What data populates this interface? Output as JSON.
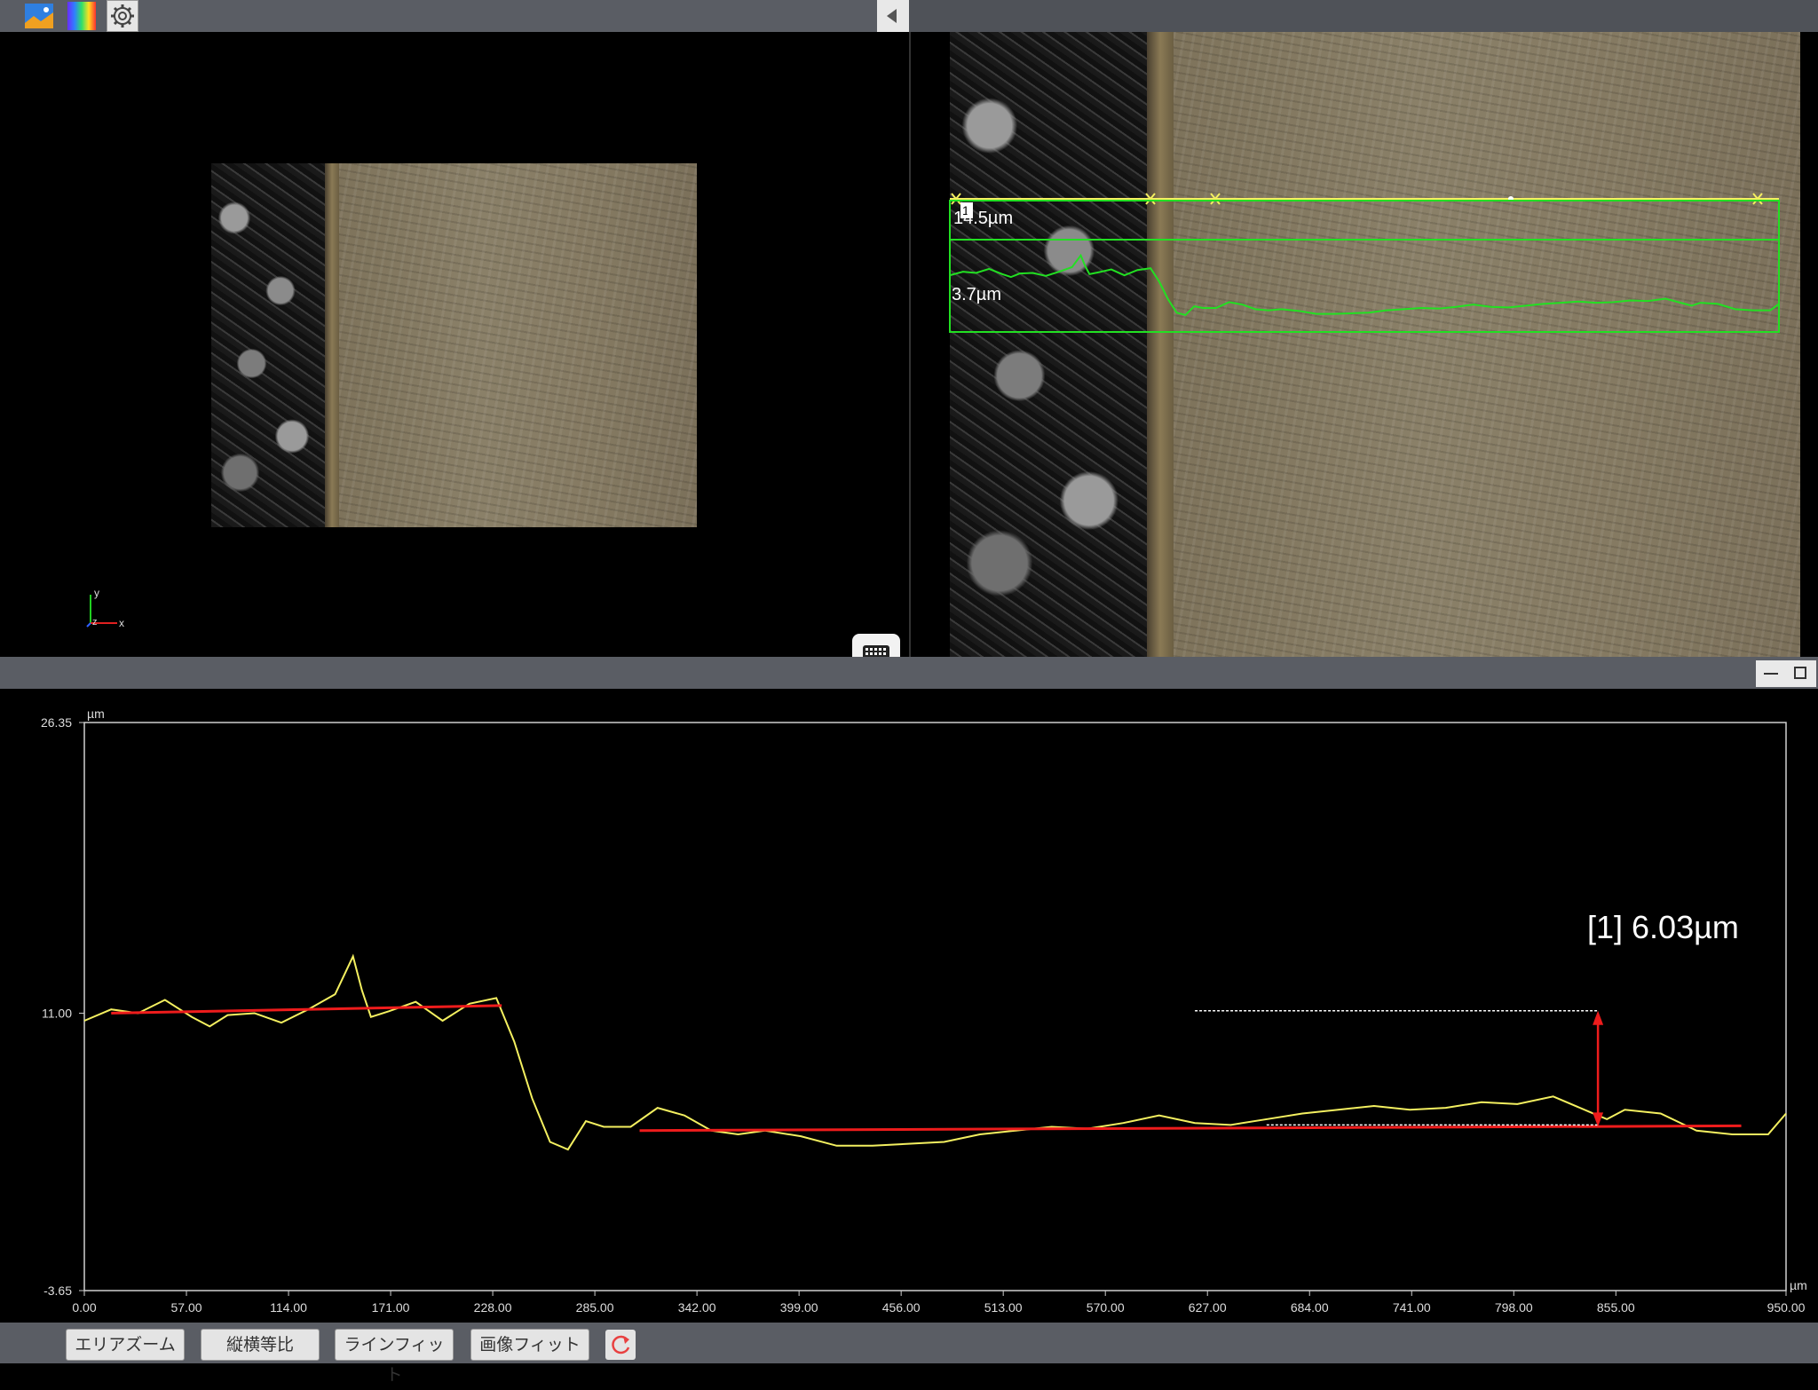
{
  "toolbar": {
    "icons": [
      "image-mode-icon",
      "color-map-icon",
      "gear-icon"
    ],
    "collapse": "chevron-left-icon"
  },
  "views": {
    "left_axes": {
      "y": "y",
      "z": "z",
      "x": "x"
    },
    "right_overlay": {
      "box_marker": "1",
      "upper_label": "14.5µm",
      "lower_label": "3.7µm",
      "colors": {
        "profile_line": "#f4f060",
        "box": "#22e022",
        "trace": "#22e022"
      }
    }
  },
  "chart": {
    "y_unit": "µm",
    "x_unit": "µm",
    "y_ticks": [
      "26.35",
      "11.00",
      "-3.65"
    ],
    "x_ticks": [
      "0.00",
      "57.00",
      "114.00",
      "171.00",
      "228.00",
      "285.00",
      "342.00",
      "399.00",
      "456.00",
      "513.00",
      "570.00",
      "627.00",
      "684.00",
      "741.00",
      "798.00",
      "855.00",
      "950.00"
    ],
    "measurement_label": "[1] 6.03µm",
    "colors": {
      "profile": "#f4f060",
      "fit_line": "#ee1c1c",
      "arrow": "#ee1c1c",
      "frame": "#cfcfcf"
    }
  },
  "chart_data": {
    "type": "line",
    "xlim": [
      0,
      950
    ],
    "ylim": [
      -3.65,
      26.35
    ],
    "xlabel": "µm",
    "ylabel": "µm",
    "series": [
      {
        "x": [
          0,
          15,
          30,
          45,
          60,
          70,
          80,
          95,
          110,
          125,
          140,
          150,
          155,
          160,
          170,
          185,
          200,
          215,
          230,
          240,
          250,
          260,
          270,
          280,
          290,
          305,
          320,
          335,
          350,
          365,
          380,
          400,
          420,
          440,
          460,
          480,
          500,
          520,
          540,
          560,
          580,
          600,
          620,
          640,
          660,
          680,
          700,
          720,
          740,
          760,
          780,
          800,
          820,
          840,
          850,
          860,
          880,
          900,
          920,
          940,
          950
        ],
        "y": [
          10.6,
          11.2,
          11.0,
          11.7,
          10.8,
          10.3,
          10.9,
          11.0,
          10.5,
          11.2,
          12.0,
          14.0,
          12.2,
          10.8,
          11.1,
          11.6,
          10.6,
          11.5,
          11.8,
          9.5,
          6.5,
          4.2,
          3.8,
          5.3,
          5.0,
          5.0,
          6.0,
          5.6,
          4.8,
          4.6,
          4.8,
          4.5,
          4.0,
          4.0,
          4.1,
          4.2,
          4.6,
          4.8,
          5.0,
          4.9,
          5.2,
          5.6,
          5.2,
          5.1,
          5.4,
          5.7,
          5.9,
          6.1,
          5.9,
          6.0,
          6.3,
          6.2,
          6.6,
          5.8,
          5.4,
          5.9,
          5.7,
          4.8,
          4.6,
          4.6,
          5.7
        ]
      }
    ],
    "fit_lines": [
      {
        "x": [
          15,
          233
        ],
        "y": [
          11.0,
          11.4
        ]
      },
      {
        "x": [
          310,
          925
        ],
        "y": [
          4.8,
          5.05
        ]
      }
    ],
    "measurement": {
      "label": "[1] 6.03µm",
      "x": 845,
      "y_low": 5.1,
      "y_high": 11.13
    }
  }
}
